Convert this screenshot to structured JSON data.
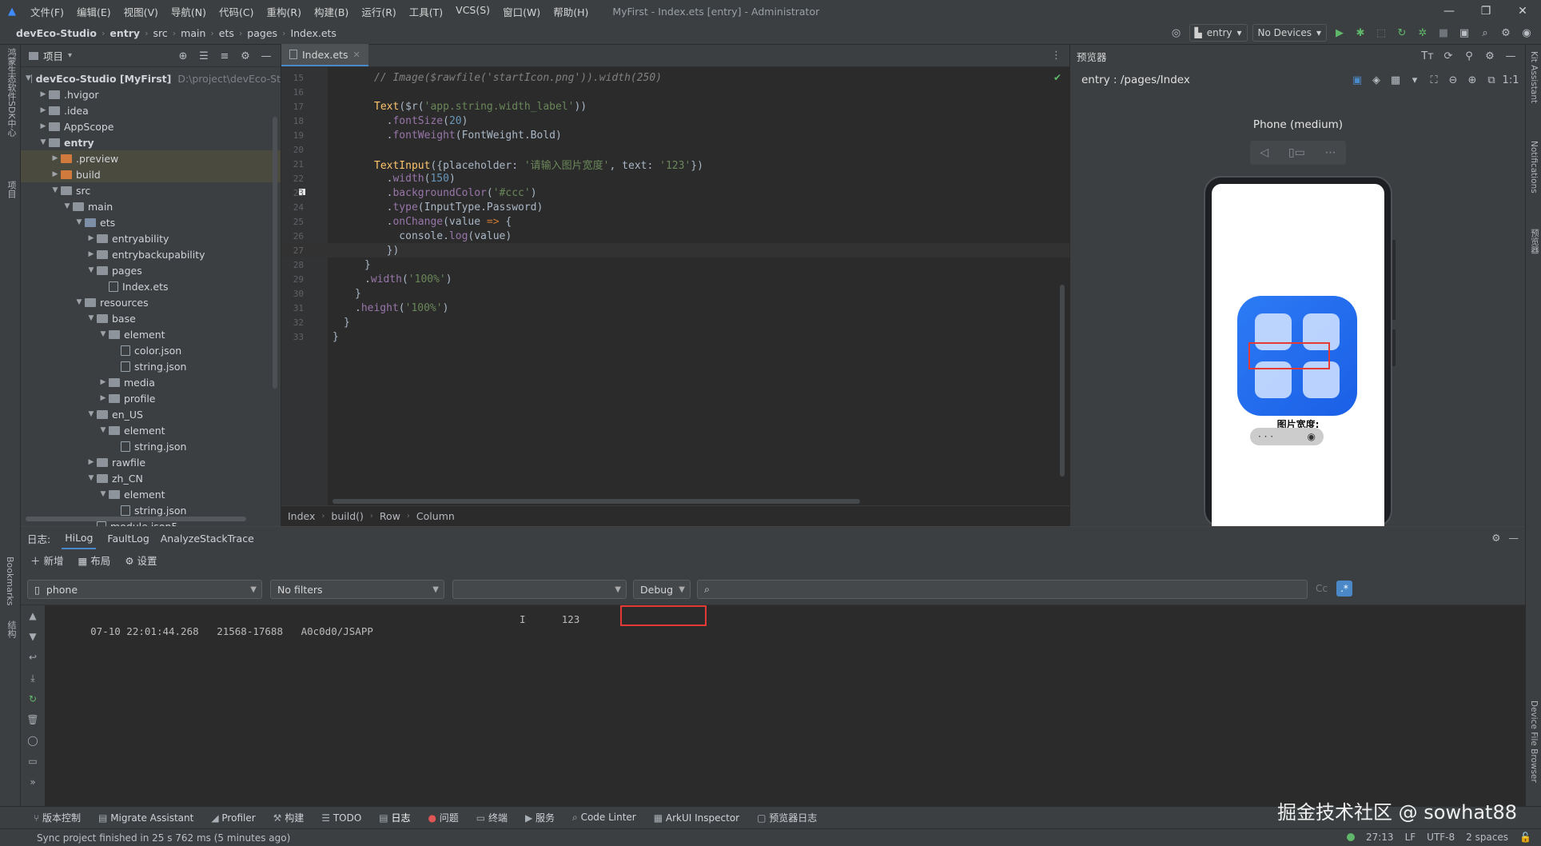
{
  "titlebar": {
    "menu": [
      "文件(F)",
      "编辑(E)",
      "视图(V)",
      "导航(N)",
      "代码(C)",
      "重构(R)",
      "构建(B)",
      "运行(R)",
      "工具(T)",
      "VCS(S)",
      "窗口(W)",
      "帮助(H)"
    ],
    "window_title": "MyFirst - Index.ets [entry] - Administrator"
  },
  "breadcrumb": [
    "devEco-Studio",
    "entry",
    "src",
    "main",
    "ets",
    "pages",
    "Index.ets"
  ],
  "toolbar": {
    "module": "entry",
    "devices": "No Devices"
  },
  "leftstrip": {
    "top_label": "鸿蒙生态软件SDK中心",
    "project_label": "项目",
    "bookmarks": "Bookmarks",
    "structure": "结构"
  },
  "project": {
    "title": "项目",
    "tree": [
      {
        "label": "devEco-Studio [MyFirst]",
        "extra": "D:\\project\\devEco-St",
        "depth": 0,
        "type": "root",
        "open": true
      },
      {
        "label": ".hvigor",
        "depth": 1,
        "type": "folder",
        "open": false
      },
      {
        "label": ".idea",
        "depth": 1,
        "type": "folder",
        "open": false
      },
      {
        "label": "AppScope",
        "depth": 1,
        "type": "folder",
        "open": false
      },
      {
        "label": "entry",
        "depth": 1,
        "type": "folder",
        "open": true,
        "bold": true
      },
      {
        "label": ".preview",
        "depth": 2,
        "type": "folder-orange",
        "open": false,
        "sel": true
      },
      {
        "label": "build",
        "depth": 2,
        "type": "folder-orange",
        "open": false,
        "sel": true
      },
      {
        "label": "src",
        "depth": 2,
        "type": "folder",
        "open": true
      },
      {
        "label": "main",
        "depth": 3,
        "type": "folder",
        "open": true
      },
      {
        "label": "ets",
        "depth": 4,
        "type": "folder-blue",
        "open": true
      },
      {
        "label": "entryability",
        "depth": 5,
        "type": "folder",
        "open": false
      },
      {
        "label": "entrybackupability",
        "depth": 5,
        "type": "folder",
        "open": false
      },
      {
        "label": "pages",
        "depth": 5,
        "type": "folder",
        "open": true
      },
      {
        "label": "Index.ets",
        "depth": 6,
        "type": "file"
      },
      {
        "label": "resources",
        "depth": 4,
        "type": "folder",
        "open": true
      },
      {
        "label": "base",
        "depth": 5,
        "type": "folder",
        "open": true
      },
      {
        "label": "element",
        "depth": 6,
        "type": "folder",
        "open": true
      },
      {
        "label": "color.json",
        "depth": 7,
        "type": "file"
      },
      {
        "label": "string.json",
        "depth": 7,
        "type": "file"
      },
      {
        "label": "media",
        "depth": 6,
        "type": "folder",
        "open": false
      },
      {
        "label": "profile",
        "depth": 6,
        "type": "folder",
        "open": false
      },
      {
        "label": "en_US",
        "depth": 5,
        "type": "folder",
        "open": true
      },
      {
        "label": "element",
        "depth": 6,
        "type": "folder",
        "open": true
      },
      {
        "label": "string.json",
        "depth": 7,
        "type": "file"
      },
      {
        "label": "rawfile",
        "depth": 5,
        "type": "folder",
        "open": false
      },
      {
        "label": "zh_CN",
        "depth": 5,
        "type": "folder",
        "open": true
      },
      {
        "label": "element",
        "depth": 6,
        "type": "folder",
        "open": true
      },
      {
        "label": "string.json",
        "depth": 7,
        "type": "file"
      },
      {
        "label": "module.json5",
        "depth": 5,
        "type": "file"
      }
    ]
  },
  "editor": {
    "tab": "Index.ets",
    "current_line": 27,
    "lines": [
      {
        "n": "15",
        "tokens": [
          [
            "com",
            "// Image($rawfile('startIcon.png')).width(250)"
          ]
        ]
      },
      {
        "n": "16",
        "tokens": []
      },
      {
        "n": "17",
        "tokens": [
          [
            "fn",
            "Text"
          ],
          [
            "plain",
            "($r("
          ],
          [
            "str",
            "'app.string.width_label'"
          ],
          [
            "plain",
            "))"
          ]
        ]
      },
      {
        "n": "18",
        "tokens": [
          [
            "plain",
            "  ."
          ],
          [
            "prop",
            "fontSize"
          ],
          [
            "plain",
            "("
          ],
          [
            "num",
            "20"
          ],
          [
            "plain",
            ")"
          ]
        ]
      },
      {
        "n": "19",
        "tokens": [
          [
            "plain",
            "  ."
          ],
          [
            "prop",
            "fontWeight"
          ],
          [
            "plain",
            "(FontWeight.Bold)"
          ]
        ]
      },
      {
        "n": "20",
        "tokens": []
      },
      {
        "n": "21",
        "tokens": [
          [
            "fn",
            "TextInput"
          ],
          [
            "plain",
            "({placeholder: "
          ],
          [
            "str",
            "'请输入图片宽度'"
          ],
          [
            "plain",
            ", text: "
          ],
          [
            "str",
            "'123'"
          ],
          [
            "plain",
            "})"
          ]
        ]
      },
      {
        "n": "22",
        "tokens": [
          [
            "plain",
            "  ."
          ],
          [
            "prop",
            "width"
          ],
          [
            "plain",
            "("
          ],
          [
            "num",
            "150"
          ],
          [
            "plain",
            ")"
          ]
        ]
      },
      {
        "n": "23",
        "tokens": [
          [
            "plain",
            "  ."
          ],
          [
            "prop",
            "backgroundColor"
          ],
          [
            "plain",
            "("
          ],
          [
            "str",
            "'#ccc'"
          ],
          [
            "plain",
            ")"
          ]
        ]
      },
      {
        "n": "24",
        "tokens": [
          [
            "plain",
            "  ."
          ],
          [
            "prop",
            "type"
          ],
          [
            "plain",
            "(InputType.Password)"
          ]
        ]
      },
      {
        "n": "25",
        "tokens": [
          [
            "plain",
            "  ."
          ],
          [
            "prop",
            "onChange"
          ],
          [
            "plain",
            "(value "
          ],
          [
            "arrow",
            "=>"
          ],
          [
            "plain",
            " {"
          ]
        ]
      },
      {
        "n": "26",
        "tokens": [
          [
            "plain",
            "    console."
          ],
          [
            "prop",
            "log"
          ],
          [
            "plain",
            "(value)"
          ]
        ]
      },
      {
        "n": "27",
        "tokens": [
          [
            "plain",
            "  })"
          ]
        ]
      },
      {
        "n": "28",
        "tokens": [
          [
            "plain",
            "}"
          ]
        ]
      },
      {
        "n": "29",
        "tokens": [
          [
            "plain",
            "."
          ],
          [
            "prop",
            "width"
          ],
          [
            "plain",
            "("
          ],
          [
            "str",
            "'100%'"
          ],
          [
            "plain",
            ")"
          ]
        ]
      },
      {
        "n": "30",
        "tokens": [
          [
            "plain",
            "}"
          ]
        ]
      },
      {
        "n": "31",
        "tokens": [
          [
            "plain",
            "."
          ],
          [
            "prop",
            "height"
          ],
          [
            "plain",
            "("
          ],
          [
            "str",
            "'100%'"
          ],
          [
            "plain",
            ")"
          ]
        ]
      },
      {
        "n": "32",
        "tokens": [
          [
            "plain",
            "}"
          ]
        ]
      },
      {
        "n": "33",
        "tokens": [
          [
            "plain",
            "}"
          ]
        ]
      }
    ],
    "breadcrumb": [
      "Index",
      "build()",
      "Row",
      "Column"
    ]
  },
  "preview": {
    "title": "预览器",
    "route": "entry : /pages/Index",
    "device": "Phone (medium)",
    "label": "图片宽度:",
    "password_mask": "· · ·"
  },
  "rightstrip": [
    "Kit Assistant",
    "Notifications",
    "预览器",
    "Device File Browser"
  ],
  "log": {
    "label": "日志:",
    "tabs": [
      "HiLog",
      "FaultLog",
      "AnalyzeStackTrace"
    ],
    "actions": [
      "新增",
      "布局",
      "设置"
    ],
    "device": "phone",
    "filter": "No filters",
    "level": "Debug",
    "line": {
      "time": "07-10 22:01:44.268",
      "pid": "21568-17688",
      "tag": "A0c0d0/JSAPP",
      "level": "I",
      "msg": "123"
    }
  },
  "bottombar": [
    "版本控制",
    "Migrate Assistant",
    "Profiler",
    "构建",
    "TODO",
    "日志",
    "问题",
    "终端",
    "服务",
    "Code Linter",
    "ArkUI Inspector",
    "预览器日志"
  ],
  "statusbar": {
    "message": "Sync project finished in 25 s 762 ms (5 minutes ago)",
    "position": "27:13",
    "line_sep": "LF",
    "encoding": "UTF-8",
    "indent": "2 spaces"
  },
  "watermark": "掘金技术社区 @ sowhat88",
  "colors": {
    "accent": "#4a88c7",
    "highlight_red": "#e53935",
    "app_icon": "#2d7bf5"
  }
}
